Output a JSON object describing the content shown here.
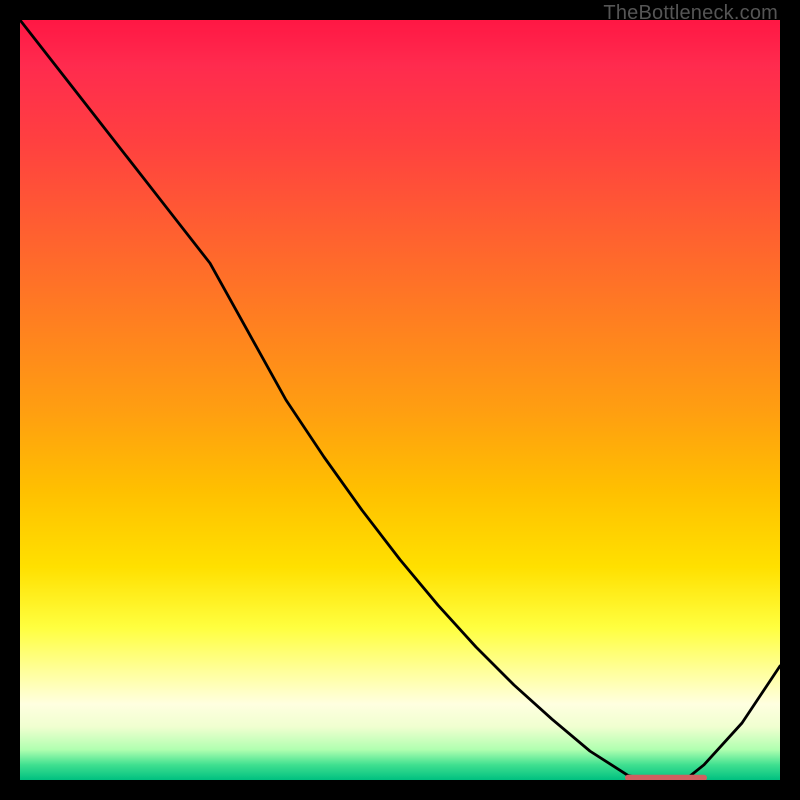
{
  "watermark": "TheBottleneck.com",
  "chart_data": {
    "type": "line",
    "title": "",
    "xlabel": "",
    "ylabel": "",
    "x": [
      0.0,
      0.05,
      0.1,
      0.15,
      0.2,
      0.25,
      0.3,
      0.35,
      0.4,
      0.45,
      0.5,
      0.55,
      0.6,
      0.65,
      0.7,
      0.75,
      0.8,
      0.825,
      0.85,
      0.875,
      0.9,
      0.95,
      1.0
    ],
    "values": [
      1.0,
      0.936,
      0.872,
      0.808,
      0.744,
      0.68,
      0.59,
      0.5,
      0.425,
      0.355,
      0.29,
      0.23,
      0.175,
      0.125,
      0.08,
      0.038,
      0.006,
      0.0,
      0.0,
      0.0,
      0.02,
      0.075,
      0.15
    ],
    "xlim": [
      0,
      1
    ],
    "ylim": [
      0,
      1
    ],
    "flat_segment": {
      "x": [
        0.8,
        0.9
      ],
      "y": 0.003,
      "color": "#d06060"
    },
    "grid": false,
    "legend": false
  }
}
